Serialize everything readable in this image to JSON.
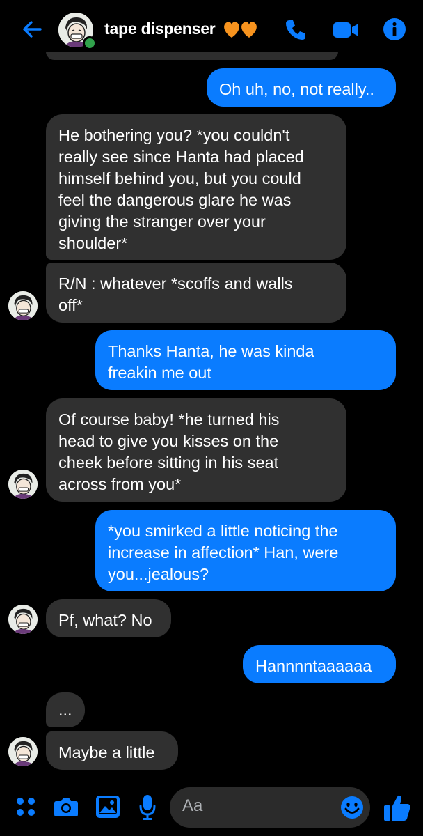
{
  "header": {
    "title": "tape dispenser",
    "icons": [
      "back-arrow-icon",
      "phone-icon",
      "video-camera-icon",
      "info-icon"
    ],
    "accent_color": "#0a7cff",
    "heart_color": "#f7931e"
  },
  "messages": [
    {
      "side": "out",
      "text": "Oh uh, no, not really.."
    },
    {
      "side": "in",
      "text": "He bothering you? *you couldn't\nreally see since Hanta had placed\nhimself behind you, but you could\nfeel the dangerous glare he was\ngiving the stranger over your\nshoulder*"
    },
    {
      "side": "in",
      "text": "R/N : whatever *scoffs and walls\noff*"
    },
    {
      "side": "out",
      "text": "Thanks Hanta, he was kinda\nfreakin me out"
    },
    {
      "side": "in",
      "text": "Of course baby! *he turned his\nhead to give you kisses on the\ncheek before sitting in his seat\nacross from you*"
    },
    {
      "side": "out",
      "text": "*you smirked a little noticing the\nincrease in affection* Han, were\nyou...jealous?"
    },
    {
      "side": "in",
      "text": "Pf, what? No"
    },
    {
      "side": "out",
      "text": "Hannnntaaaaaa"
    },
    {
      "side": "in",
      "text": "..."
    },
    {
      "side": "in",
      "text": "Maybe a little"
    }
  ],
  "composer": {
    "placeholder": "Aa",
    "icons": [
      "apps-icon",
      "camera-icon",
      "gallery-icon",
      "microphone-icon",
      "emoji-icon",
      "thumbs-up-icon"
    ]
  }
}
